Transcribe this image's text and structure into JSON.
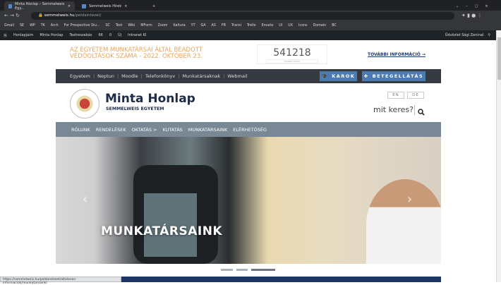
{
  "browser": {
    "tabs": [
      {
        "label": "Minta Honlap – Semmelweis Egy..."
      },
      {
        "label": "Semmelweis Hírek"
      }
    ],
    "url_host": "semmelweis.hu",
    "url_path": "/peldaintezet/",
    "bookmarks": [
      "Gmail",
      "SE",
      "WP",
      "TK",
      "Arch",
      "For Prospective Stu...",
      "SC",
      "Test",
      "Wiki",
      "MForm",
      "Zoom",
      "Kaltura",
      "YT",
      "GA",
      "AS",
      "FB",
      "Transl",
      "Trello",
      "Envato",
      "UI",
      "UX",
      "Icons",
      "Domain",
      "BC"
    ],
    "status_url": "https://semmelweis.hu/peldaintezet/altalanos-informaciok/munkatarsaink/"
  },
  "wp_admin": {
    "items": [
      "Honlapjaim",
      "Minta Honlap",
      "Testreszabás",
      "66",
      "0",
      "Új",
      "Intranet KI"
    ],
    "greeting": "Üdvözlet Sági Zeninal"
  },
  "banner": {
    "line1": "AZ EGYETEM MUNKATÁRSAI ÁLTAL BEADOTT",
    "line2": "VÉDŐOLTÁSOK SZÁMA - 2022. OKTÓBER 23.",
    "count": "541218",
    "count_label": "ÖSSZES OLTÁS",
    "more": "TOVÁBBI INFORMÁCIÓ →"
  },
  "topnav": {
    "links": [
      "Egyetem",
      "Neptun",
      "Moodle",
      "Telefonkönyv",
      "Munkatársaknak",
      "Webmail"
    ],
    "karok": "KAROK",
    "betegellatas": "BETEGELLÁTÁS"
  },
  "header": {
    "title": "Minta Honlap",
    "subtitle": "SEMMELWEIS EGYETEM",
    "lang_en": "EN",
    "lang_de": "DE",
    "search": "mit keres?"
  },
  "menu": [
    "RÓLUNK",
    "RENDELÉSEK",
    "OKTATÁS >",
    "KUTATÁS",
    "MUNKATÁRSAINK",
    "ELÉRHETŐSÉG"
  ],
  "hero": {
    "title": "MUNKATÁRSAINK",
    "active_slide": 3,
    "slides": 3
  },
  "colors": {
    "accent": "#e6a65c",
    "brand": "#1c2b4a",
    "button": "#4b7bb0",
    "menu": "#7a8896"
  }
}
